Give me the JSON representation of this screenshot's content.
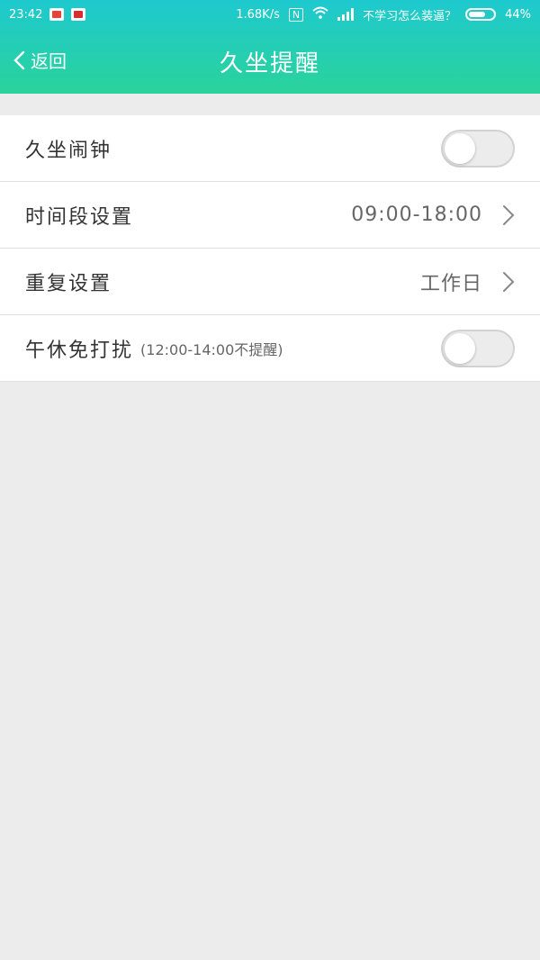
{
  "status_bar": {
    "time": "23:42",
    "speed": "1.68K/s",
    "nfc_label": "N",
    "carrier": "不学习怎么装逼？",
    "battery": "44%",
    "battery_level": 0.44
  },
  "header": {
    "back_label": "返回",
    "title": "久坐提醒"
  },
  "settings": {
    "rows": [
      {
        "label": "久坐闹钟",
        "type": "toggle",
        "checked": false
      },
      {
        "label": "时间段设置",
        "value": "09:00-18:00",
        "type": "nav"
      },
      {
        "label": "重复设置",
        "value": "工作日",
        "type": "nav"
      },
      {
        "label": "午休免打扰",
        "sublabel": "(12:00-14:00不提醒)",
        "type": "toggle",
        "checked": false
      }
    ]
  },
  "colors": {
    "header_top": "#1ec9cf",
    "header_bottom": "#2ad39a",
    "background": "#ebeceb"
  }
}
